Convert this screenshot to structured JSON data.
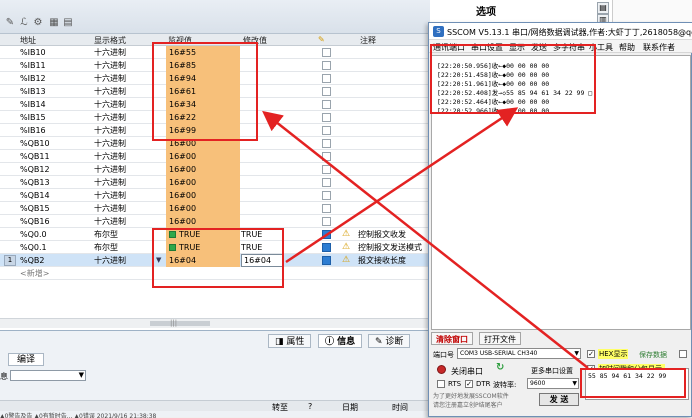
{
  "grid": {
    "headers": {
      "address": "地址",
      "format": "显示格式",
      "monitor": "监视值",
      "modify": "修改值",
      "note": "注释"
    },
    "rows": [
      {
        "address": "%IB10",
        "format": "十六进制",
        "monitor": "16#55",
        "modify": "",
        "checked": false,
        "warn": false,
        "note": ""
      },
      {
        "address": "%IB11",
        "format": "十六进制",
        "monitor": "16#85",
        "modify": "",
        "checked": false,
        "warn": false,
        "note": ""
      },
      {
        "address": "%IB12",
        "format": "十六进制",
        "monitor": "16#94",
        "modify": "",
        "checked": false,
        "warn": false,
        "note": ""
      },
      {
        "address": "%IB13",
        "format": "十六进制",
        "monitor": "16#61",
        "modify": "",
        "checked": false,
        "warn": false,
        "note": ""
      },
      {
        "address": "%IB14",
        "format": "十六进制",
        "monitor": "16#34",
        "modify": "",
        "checked": false,
        "warn": false,
        "note": ""
      },
      {
        "address": "%IB15",
        "format": "十六进制",
        "monitor": "16#22",
        "modify": "",
        "checked": false,
        "warn": false,
        "note": ""
      },
      {
        "address": "%IB16",
        "format": "十六进制",
        "monitor": "16#99",
        "modify": "",
        "checked": false,
        "warn": false,
        "note": ""
      },
      {
        "address": "%QB10",
        "format": "十六进制",
        "monitor": "16#00",
        "modify": "",
        "checked": false,
        "warn": false,
        "note": ""
      },
      {
        "address": "%QB11",
        "format": "十六进制",
        "monitor": "16#00",
        "modify": "",
        "checked": false,
        "warn": false,
        "note": ""
      },
      {
        "address": "%QB12",
        "format": "十六进制",
        "monitor": "16#00",
        "modify": "",
        "checked": false,
        "warn": false,
        "note": ""
      },
      {
        "address": "%QB13",
        "format": "十六进制",
        "monitor": "16#00",
        "modify": "",
        "checked": false,
        "warn": false,
        "note": ""
      },
      {
        "address": "%QB14",
        "format": "十六进制",
        "monitor": "16#00",
        "modify": "",
        "checked": false,
        "warn": false,
        "note": ""
      },
      {
        "address": "%QB15",
        "format": "十六进制",
        "monitor": "16#00",
        "modify": "",
        "checked": false,
        "warn": false,
        "note": ""
      },
      {
        "address": "%QB16",
        "format": "十六进制",
        "monitor": "16#00",
        "modify": "",
        "checked": false,
        "warn": false,
        "note": ""
      },
      {
        "address": "%Q0.0",
        "format": "布尔型",
        "monitor": "TRUE",
        "modify": "TRUE",
        "checked": true,
        "warn": true,
        "note": "控制报文收发",
        "bool": true
      },
      {
        "address": "%Q0.1",
        "format": "布尔型",
        "monitor": "TRUE",
        "modify": "TRUE",
        "checked": true,
        "warn": true,
        "note": "控制报文发送模式",
        "bool": true
      },
      {
        "address": "%QB2",
        "format": "十六进制",
        "monitor": "16#04",
        "modify": "16#04",
        "checked": true,
        "warn": true,
        "note": "报文接收长度",
        "selected": true,
        "row_num": "1"
      },
      {
        "address": "<新增>",
        "format": "",
        "monitor": "",
        "modify": "",
        "checked": false,
        "warn": false,
        "note": "",
        "new": true
      }
    ]
  },
  "props_title": "选项",
  "bottom": {
    "tab_props": "属性",
    "tab_info": "信息",
    "tab_diag": "诊断",
    "edit_tab": "编译",
    "info_label": "息",
    "msg_headers": {
      "goto": "转至",
      "q": "?",
      "date": "日期",
      "time": "时间"
    },
    "status": "▲0警告及告  ▲0有暂时告... ▲0错误  2021/9/16  21:38:38"
  },
  "sscom": {
    "title": "SSCOM V5.13.1 串口/网络数据调试器,作者:大虾丁丁,2618058@qq.com",
    "menu": [
      "通讯端口",
      "串口设置",
      "显示",
      "发送",
      "多字符串",
      "小工具",
      "帮助",
      "联系作者"
    ],
    "recv_lines": [
      "[22:20:50.956]收←◆00 00 00 00",
      "[22:20:51.458]收←◆00 00 00 00",
      "[22:20:51.961]收←◆00 00 00 00",
      "[22:20:52.408]发→◇55 85 94 61 34 22 99 □",
      "[22:20:52.464]收←◆00 00 00 00",
      "[22:20:52.966]收←◆00 00 00 00"
    ],
    "tab_clear": "清除窗口",
    "tab_open": "打开文件",
    "port_label": "端口号",
    "port_value": "COM3 USB-SERIAL CH340",
    "hex_display": "HEX显示",
    "save_data": "保存数据",
    "close_port": "关闭串口",
    "more_settings": "更多串口设置",
    "timestamp_label": "加时间戳和分包显示,",
    "rts": "RTS",
    "dtr": "DTR",
    "baud_label": "波特率:",
    "baud_value": "9600",
    "send_text": "55 85 94 61 34 22 99",
    "send_button": "发 送",
    "promo1": "为了更好地发展SSCOM软件",
    "promo2": "请您注册嘉立创P结尾客户"
  }
}
